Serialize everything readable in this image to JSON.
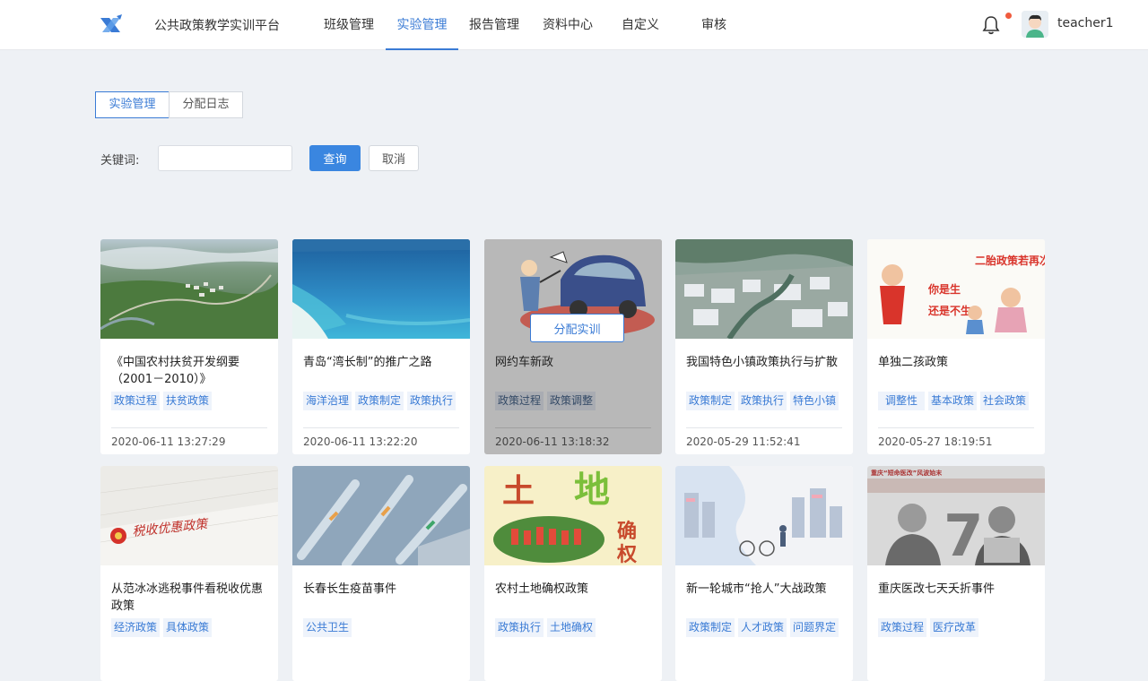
{
  "header": {
    "brand": "公共政策教学实训平台",
    "nav": [
      {
        "label": "班级管理"
      },
      {
        "label": "实验管理",
        "active": true
      },
      {
        "label": "报告管理"
      },
      {
        "label": "资料中心"
      },
      {
        "label": "自定义"
      },
      {
        "label": "审核"
      }
    ],
    "notification_icon": "bell-icon",
    "has_unread": true,
    "username": "teacher1"
  },
  "tabs": [
    {
      "label": "实验管理",
      "active": true
    },
    {
      "label": "分配日志"
    }
  ],
  "search": {
    "label": "关键词:",
    "value": "",
    "query_label": "查询",
    "cancel_label": "取消"
  },
  "cards": [
    {
      "title": "《中国农村扶贫开发纲要（2001－2010）》",
      "tags": [
        "政策过程",
        "扶贫政策"
      ],
      "date": "2020-06-11 13:27:29"
    },
    {
      "title": "青岛“湾长制”的推广之路",
      "tags": [
        "海洋治理",
        "政策制定",
        "政策执行"
      ],
      "date": "2020-06-11 13:22:20"
    },
    {
      "title": "网约车新政",
      "tags": [
        "政策过程",
        "政策调整"
      ],
      "date": "2020-06-11 13:18:32",
      "hover_button": "分配实训"
    },
    {
      "title": "我国特色小镇政策执行与扩散",
      "tags": [
        "政策制定",
        "政策执行",
        "特色小镇"
      ],
      "date": "2020-05-29 11:52:41"
    },
    {
      "title": "单独二孩政策",
      "tags": [
        "调整性",
        "基本政策",
        "社会政策"
      ],
      "date": "2020-05-27 18:19:51",
      "image_text": "二胎政策若再次放开 你是生 还是不生"
    },
    {
      "title": "从范冰冰逃税事件看税收优惠政策",
      "tags": [
        "经济政策",
        "具体政策"
      ],
      "date": "",
      "image_text": "税收优惠政策"
    },
    {
      "title": "长春长生疫苗事件",
      "tags": [
        "公共卫生"
      ],
      "date": ""
    },
    {
      "title": "农村土地确权政策",
      "tags": [
        "政策执行",
        "土地确权"
      ],
      "date": "",
      "image_text": "土地确权"
    },
    {
      "title": "新一轮城市“抢人”大战政策",
      "tags": [
        "政策制定",
        "人才政策",
        "问题界定"
      ],
      "date": ""
    },
    {
      "title": "重庆医改七天夭折事件",
      "tags": [
        "政策过程",
        "医疗改革"
      ],
      "date": "",
      "image_text": "重庆“短命医改”风波始末"
    }
  ]
}
